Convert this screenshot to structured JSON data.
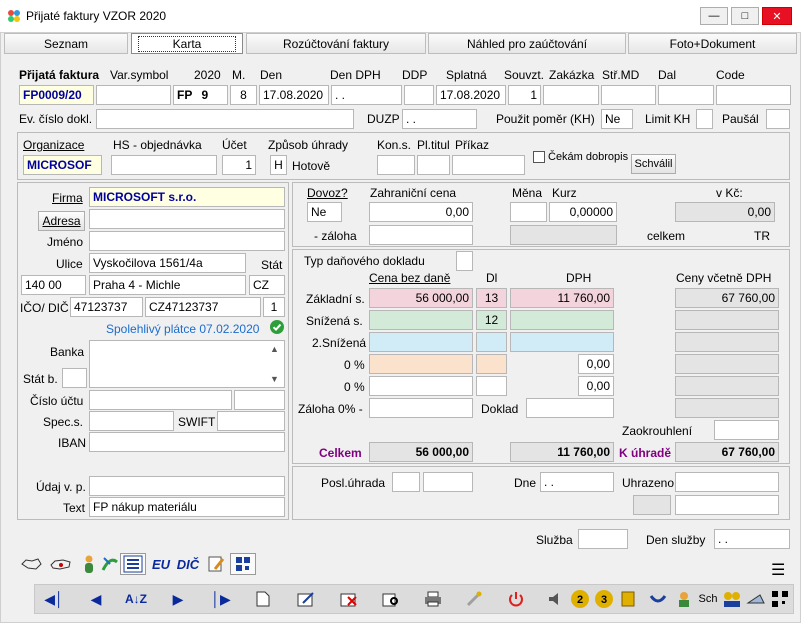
{
  "window": {
    "title": "Přijaté faktury VZOR  2020"
  },
  "tabs": [
    "Seznam",
    "Karta",
    "Rozúčtování faktury",
    "Náhled pro zaúčtování",
    "Foto+Dokument"
  ],
  "header": {
    "labels": {
      "prijata": "Přijatá faktura",
      "varsym": "Var.symbol",
      "year": "2020",
      "m": "M.",
      "den": "Den",
      "dendph": "Den DPH",
      "ddp": "DDP",
      "splatna": "Splatná",
      "souvzt": "Souvzt.",
      "zakazka": "Zakázka",
      "strmd": "Stř.MD",
      "dal": "Dal",
      "code": "Code"
    },
    "doc_no": "FP0009/20",
    "varsym": "",
    "series": "FP",
    "series_no": "9",
    "month": "8",
    "den": "17.08.2020",
    "dendph": " .  .",
    "ddp": "",
    "splatna": "17.08.2020",
    "souvzt": "1",
    "zakazka": "",
    "strmd": "",
    "dal": "",
    "code": ""
  },
  "row2": {
    "ev_label": "Ev. číslo dokl.",
    "ev_value": "",
    "duzp_label": "DUZP",
    "duzp_value": " .  .",
    "pomer_label": "Použit poměr (KH)",
    "pomer_value": "Ne",
    "limit_label": "Limit KH",
    "limit_value": "",
    "pausal_label": "Paušál",
    "pausal_value": ""
  },
  "org": {
    "org_label": "Organizace",
    "org_value": "MICROSOF",
    "hs_label": "HS - objednávka",
    "hs_value": "",
    "ucet_label": "Účet",
    "ucet_value": "1",
    "zpusob_label": "Způsob úhrady",
    "zpusob_code": "H",
    "zpusob_text": "Hotově",
    "kons_label": "Kon.s.",
    "pl_label": "Pl.titul",
    "prikaz_label": "Příkaz",
    "cekam_label": "Čekám dobropis",
    "schvalil": "Schválil"
  },
  "firm": {
    "firma_label": "Firma",
    "firma": "MICROSOFT s.r.o.",
    "adresa_btn": "Adresa",
    "firma2": "",
    "jmeno_label": "Jméno",
    "jmeno": "",
    "ulice_label": "Ulice",
    "ulice": "Vyskočilova 1561/4a",
    "stat_label": "Stát",
    "psc": "140 00",
    "mesto": "Praha 4 - Michle",
    "stat": "CZ",
    "ico_label": "IČO/ DIČ",
    "ico": "47123737",
    "dic": "CZ47123737",
    "ico_flag": "1",
    "spolehlivy": "Spolehlivý plátce 07.02.2020",
    "banka_label": "Banka",
    "statb_label": "Stát b.",
    "cislo_label": "Číslo účtu",
    "spec_label": "Spec.s.",
    "swift_label": "SWIFT",
    "iban_label": "IBAN",
    "udaj_label": "Údaj v. p.",
    "text_label": "Text",
    "text": "FP nákup materiálu"
  },
  "foreign": {
    "dovoz_label": "Dovoz?",
    "dovoz": "Ne",
    "zahr_label": "Zahraniční cena",
    "zahr": "0,00",
    "mena_label": "Měna",
    "kurz_label": "Kurz",
    "kurz": "0,00000",
    "vkc_label": "v Kč:",
    "vkc": "0,00",
    "zaloha_label": "- záloha",
    "celkem_label": "celkem",
    "tr_label": "TR"
  },
  "vat": {
    "typ_label": "Typ daňového dokladu",
    "cena_label": "Cena bez daně",
    "dl_label": "Dl",
    "dph_label": "DPH",
    "cenyv_label": "Ceny včetně DPH",
    "rows": [
      {
        "label": "Základní s.",
        "base": "56 000,00",
        "rate": "13",
        "dph": "11 760,00",
        "total": "67 760,00"
      },
      {
        "label": "Snížená s.",
        "base": "",
        "rate": "12",
        "dph": "",
        "total": ""
      },
      {
        "label": "2.Snížená",
        "base": "",
        "rate": "",
        "dph": "",
        "total": ""
      },
      {
        "label": "0 %",
        "base": "",
        "rate": "",
        "dph": "0,00",
        "total": ""
      },
      {
        "label": "0 %",
        "base": "",
        "rate": "",
        "dph": "0,00",
        "total": ""
      }
    ],
    "zaloha_label": "Záloha 0% -",
    "doklad_label": "Doklad",
    "zaokr_label": "Zaokrouhlení",
    "celkem_label": "Celkem",
    "celkem_base": "56 000,00",
    "celkem_dph": "11 760,00",
    "kuhrade_label": "K úhradě",
    "kuhrade": "67 760,00"
  },
  "payment": {
    "posl_label": "Posl.úhrada",
    "dne_label": "Dne",
    "dne": " .  .",
    "uhrazeno_label": "Uhrazeno",
    "sluzba_label": "Služba",
    "densluzby_label": "Den služby",
    "densluzby": " .  ."
  },
  "toolbar": {
    "eu": "EU",
    "dic": "DIČ"
  },
  "navbar": {
    "sch": "Sch"
  },
  "colors": {
    "accent_blue": "#0000a0",
    "purple": "#800080",
    "pink": "#f3d4dc",
    "green": "#d4ead8",
    "lightblue": "#d2ecf7",
    "peach": "#fbe2cc",
    "yellow": "#ffffe1"
  }
}
